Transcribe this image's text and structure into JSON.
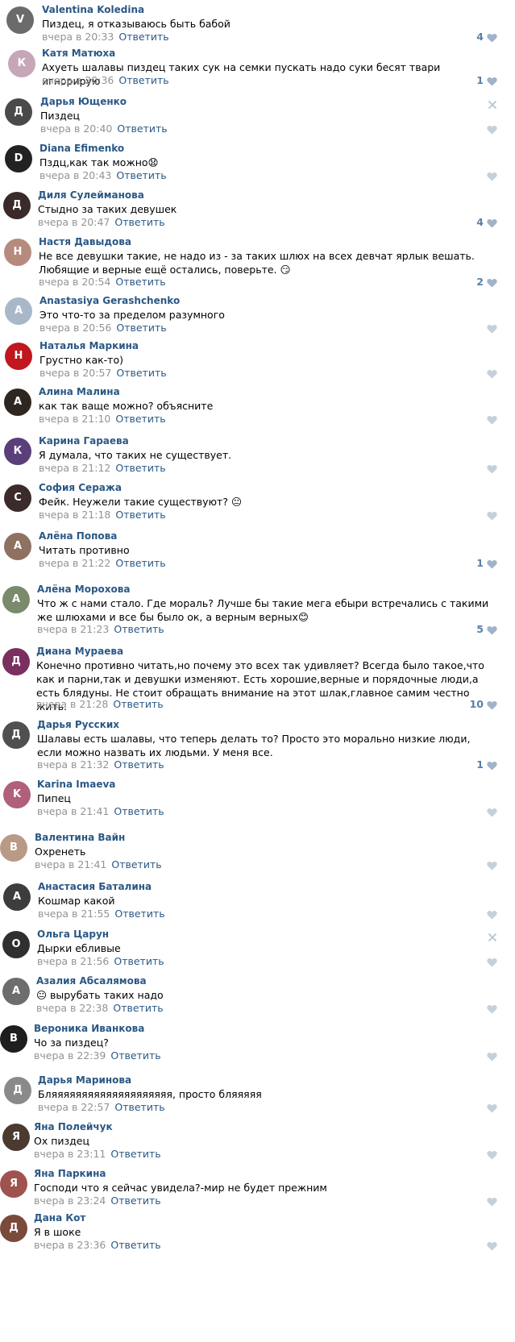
{
  "comments": [
    {
      "author": "Valentina Koledina",
      "text": "Пиздец, я отказываюсь быть бабой",
      "date": "вчера в 20:33",
      "reply": "Ответить",
      "likes": "4",
      "avatar_color": "#6b6b6b",
      "avatar_initial": "V",
      "close_visible": false
    },
    {
      "author": "Катя Матюха",
      "text": "Ахуеть шалавы пиздец таких сук на семки пускать надо суки бесят твари игнорирую",
      "date": "вчера в 20:36",
      "reply": "Ответить",
      "likes": "1",
      "avatar_color": "#c7a6b8",
      "avatar_initial": "К",
      "close_visible": false
    },
    {
      "author": "Дарья Ющенко",
      "text": "Пиздец",
      "date": "вчера в 20:40",
      "reply": "Ответить",
      "likes": "",
      "avatar_color": "#4a4a4a",
      "avatar_initial": "Д",
      "close_visible": true
    },
    {
      "author": "Diana Efimenko",
      "text": "Пздц,как так можно😧",
      "date": "вчера в 20:43",
      "reply": "Ответить",
      "likes": "",
      "avatar_color": "#222222",
      "avatar_initial": "D",
      "close_visible": false
    },
    {
      "author": "Диля Сулейманова",
      "text": "Стыдно за таких девушек",
      "date": "вчера в 20:47",
      "reply": "Ответить",
      "likes": "4",
      "avatar_color": "#3a2a2a",
      "avatar_initial": "Д",
      "close_visible": false
    },
    {
      "author": "Настя Давыдова",
      "text": "Не все девушки такие, не надо из - за таких шлюх на всех девчат ярлык вешать. Любящие и верные ещё остались, поверьте. 😏",
      "date": "вчера в 20:54",
      "reply": "Ответить",
      "likes": "2",
      "avatar_color": "#b58b7d",
      "avatar_initial": "Н",
      "close_visible": false
    },
    {
      "author": "Anastasiya Gerashchenko",
      "text": "Это что-то за пределом разумного",
      "date": "вчера в 20:56",
      "reply": "Ответить",
      "likes": "",
      "avatar_color": "#a9b8c9",
      "avatar_initial": "A",
      "close_visible": false
    },
    {
      "author": "Наталья Маркина",
      "text": "Грустно как-то)",
      "date": "вчера в 20:57",
      "reply": "Ответить",
      "likes": "",
      "avatar_color": "#c0181e",
      "avatar_initial": "Н",
      "close_visible": false
    },
    {
      "author": "Алина Малина",
      "text": "как так ваще можно? объясните",
      "date": "вчера в 21:10",
      "reply": "Ответить",
      "likes": "",
      "avatar_color": "#2e2620",
      "avatar_initial": "А",
      "close_visible": false
    },
    {
      "author": "Карина Гараева",
      "text": "Я думала, что таких не существует.",
      "date": "вчера в 21:12",
      "reply": "Ответить",
      "likes": "",
      "avatar_color": "#5a3f7a",
      "avatar_initial": "К",
      "close_visible": false
    },
    {
      "author": "София Сеража",
      "text": "Фейк. Неужели такие существуют? 😐",
      "date": "вчера в 21:18",
      "reply": "Ответить",
      "likes": "",
      "avatar_color": "#3b2b2b",
      "avatar_initial": "С",
      "close_visible": false
    },
    {
      "author": "Алёна Попова",
      "text": "Читать противно",
      "date": "вчера в 21:22",
      "reply": "Ответить",
      "likes": "1",
      "avatar_color": "#8e7160",
      "avatar_initial": "А",
      "close_visible": false
    },
    {
      "author": "Алёна Морохова",
      "text": "Что ж с нами стало. Где мораль? Лучше бы такие мега ебыри встречались с такими же шлюхами и все бы было ок, а верным верных😊",
      "date": "вчера в 21:23",
      "reply": "Ответить",
      "likes": "5",
      "avatar_color": "#7b8a6a",
      "avatar_initial": "А",
      "close_visible": false
    },
    {
      "author": "Диана Мураева",
      "text": "Конечно противно читать,но почему это всех так удивляет? Всегда было такое,что как и парни,так и девушки изменяют. Есть хорошие,верные и порядочные люди,а есть блядуны. Не стоит обращать внимание на этот шлак,главное самим честно жить.",
      "date": "вчера в 21:28",
      "reply": "Ответить",
      "likes": "10",
      "avatar_color": "#7a2f5e",
      "avatar_initial": "Д",
      "close_visible": false
    },
    {
      "author": "Дарья Русских",
      "text": "Шалавы есть шалавы, что теперь делать то? Просто это морально низкие люди, если можно назвать их людьми. У меня все.",
      "date": "вчера в 21:32",
      "reply": "Ответить",
      "likes": "1",
      "avatar_color": "#505050",
      "avatar_initial": "Д",
      "close_visible": false
    },
    {
      "author": "Karina Imaeva",
      "text": "Пипец",
      "date": "вчера в 21:41",
      "reply": "Ответить",
      "likes": "",
      "avatar_color": "#b0607a",
      "avatar_initial": "K",
      "close_visible": false
    },
    {
      "author": "Валентина Вайн",
      "text": "Охренеть",
      "date": "вчера в 21:41",
      "reply": "Ответить",
      "likes": "",
      "avatar_color": "#b99a86",
      "avatar_initial": "В",
      "close_visible": false
    },
    {
      "author": "Анастасия Баталина",
      "text": "Кошмар какой",
      "date": "вчера в 21:55",
      "reply": "Ответить",
      "likes": "",
      "avatar_color": "#3d3d3d",
      "avatar_initial": "А",
      "close_visible": false
    },
    {
      "author": "Ольга Царун",
      "text": "Дырки ебливые",
      "date": "вчера в 21:56",
      "reply": "Ответить",
      "likes": "",
      "avatar_color": "#2f2f2f",
      "avatar_initial": "О",
      "close_visible": true
    },
    {
      "author": "Азалия Абсалямова",
      "text": "😐 вырубать таких надо",
      "date": "вчера в 22:38",
      "reply": "Ответить",
      "likes": "",
      "avatar_color": "#6d6d6d",
      "avatar_initial": "А",
      "close_visible": false
    },
    {
      "author": "Вероника Иванкова",
      "text": "Чо за пиздец?",
      "date": "вчера в 22:39",
      "reply": "Ответить",
      "likes": "",
      "avatar_color": "#1e1e1e",
      "avatar_initial": "В",
      "close_visible": false
    },
    {
      "author": "Дарья Маринова",
      "text": "Бляяяяяяяяяяяяяяяяяяяя, просто бляяяяя",
      "date": "вчера в 22:57",
      "reply": "Ответить",
      "likes": "",
      "avatar_color": "#8a8a8a",
      "avatar_initial": "Д",
      "close_visible": false
    },
    {
      "author": "Яна Полейчук",
      "text": "Ох пиздец",
      "date": "вчера в 23:11",
      "reply": "Ответить",
      "likes": "",
      "avatar_color": "#4a3a30",
      "avatar_initial": "Я",
      "close_visible": false
    },
    {
      "author": "Яна Паркина",
      "text": "Господи что я сейчас увидела?-мир не будет прежним",
      "date": "вчера в 23:24",
      "reply": "Ответить",
      "likes": "",
      "avatar_color": "#a0524e",
      "avatar_initial": "Я",
      "close_visible": false
    },
    {
      "author": "Дана Кот",
      "text": "Я в шоке",
      "date": "вчера в 23:36",
      "reply": "Ответить",
      "likes": "",
      "avatar_color": "#7a4a3a",
      "avatar_initial": "Д",
      "close_visible": false
    }
  ]
}
